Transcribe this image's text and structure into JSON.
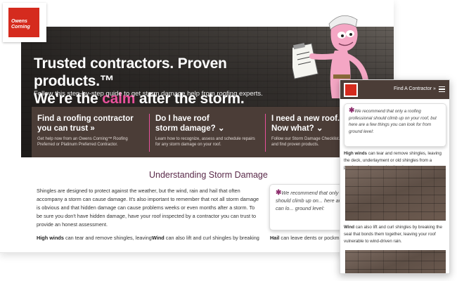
{
  "brand": {
    "logo_text": "Owens Corning",
    "accent_color": "#e8509b",
    "brand_red": "#d52b1e",
    "panel_brown": "#4b3d37"
  },
  "hero": {
    "title_line1": "Trusted contractors. Proven products.™",
    "title_line2_prefix": "We're the ",
    "title_line2_highlight": "calm",
    "title_line2_suffix": " after the storm.",
    "subtitle": "Follow this step-by-step guide to get storm damage help from roofing experts."
  },
  "cards": [
    {
      "title_line1": "Find a roofing contractor",
      "title_line2": "you can trust »",
      "desc": "Get help now from an Owens Corning™ Roofing Preferred or Platinum Preferred Contractor."
    },
    {
      "title_line1": "Do I have roof",
      "title_line2": "storm damage? ⌄",
      "desc": "Learn how to recognize, assess and schedule repairs for any storm damage on your roof."
    },
    {
      "title_line1": "I need a new roof.",
      "title_line2": "Now what? ⌄",
      "desc": "Follow our Storm Damage Checklist. Lea... contractor and find proven products."
    }
  ],
  "section": {
    "title": "Understanding Storm Damage",
    "paragraph": "Shingles are designed to protect against the weather, but the wind, rain and hail that often accompany a storm can cause damage. It's also important to remember that not all storm damage is obvious and that hidden damage can cause problems weeks or even months after a storm. To be sure you don't have hidden damage, have your roof inspected by a contractor you can trust to provide an honest assessment.",
    "callout": "We recommend that only a ro... professional should climb up on... here are a few things you can lo... ground level:",
    "col1_bold": "High winds",
    "col1_text": " can tear and remove shingles, leaving",
    "col2_bold": "Wind",
    "col2_text": " can also lift and curl shingles by breaking",
    "col3_bold": "Hail",
    "col3_text": " can leave dents or pockmark..."
  },
  "mobile": {
    "nav_link": "Find A Contractor »",
    "callout": "We recommend that only a roofing professional should climb up on your roof, but here are a few things you can look for from ground level:",
    "item1_bold": "High winds",
    "item1_text": " can tear and remove shingles, leaving the deck, underlayment or old shingles from a previous roof exposed to the elements.",
    "item2_bold": "Wind",
    "item2_text": " can also lift and curl shingles by breaking the seal that bonds them together, leaving your roof vulnerable to wind-driven rain."
  }
}
